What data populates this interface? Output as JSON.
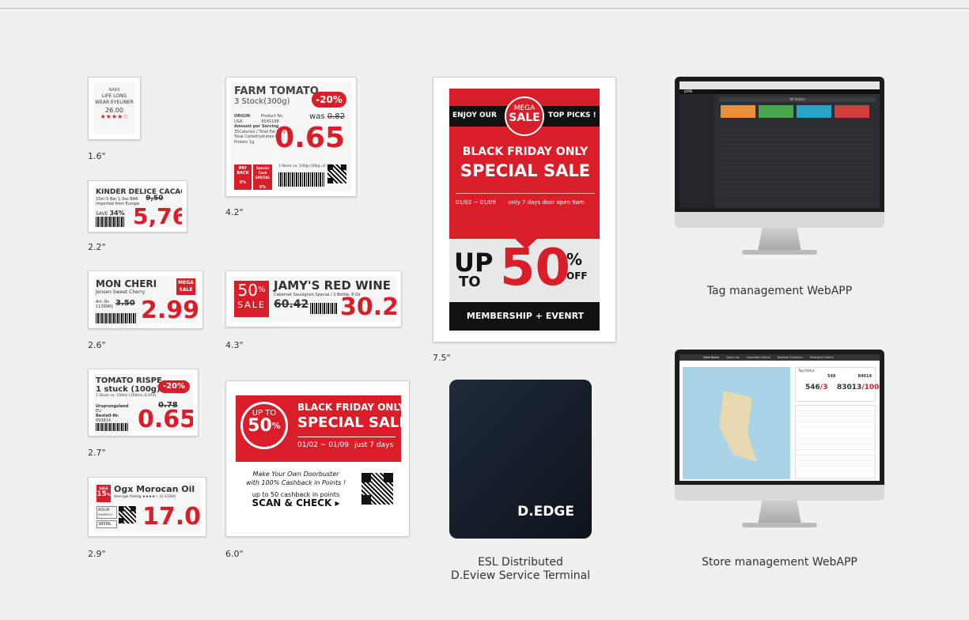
{
  "sizes": {
    "s16": "1.6\"",
    "s22": "2.2\"",
    "s26": "2.6\"",
    "s27": "2.7\"",
    "s29": "2.9\"",
    "s42": "4.2\"",
    "s43": "4.3\"",
    "s60": "6.0\"",
    "s75": "7.5\""
  },
  "tag16": {
    "brand": "NARS",
    "line1": "LIFE LONG",
    "line2": "WEAR EYELINER",
    "price": "26.00",
    "stars": "★★★★☆"
  },
  "tag22": {
    "title": "KINDER DELICE CACAO",
    "sub1": "15er 5 Bar 1.3oz BAR",
    "sub2": "Imported from Europe",
    "was": "9,50",
    "save_label": "SAVE",
    "save_pct": "34%",
    "price": "5,76"
  },
  "tag26": {
    "title": "MON CHERI",
    "sub": "Jensen Sweet Cherry",
    "badge1": "MEGA",
    "badge2": "SALE",
    "art": "Art.-Nr.",
    "artno": "1139981",
    "was": "3.50",
    "price": "2.99"
  },
  "tag27": {
    "title1": "TOMATO RISPE",
    "title2": "1 stuck (100g)",
    "badge": "-20%",
    "line": "1 Stuck ca. 150ml (100ml=0,474)",
    "origin": "Ursprungsland",
    "origin_val": "EU",
    "bestell": "Bestell-Nr.",
    "bestell_no": "093814",
    "was": "0.78",
    "price": "0.65"
  },
  "tag29": {
    "badge_top": "SALE",
    "badge_num": "15",
    "badge_pct": "%",
    "title": "Ogx Morocan Oil",
    "rating": "Average Rating ★★★★☆ (4.1/284)",
    "sub1": "AQUA",
    "sub2": "SHAMPOO",
    "size": "385ML",
    "price": "17.00"
  },
  "tag42": {
    "title": "FARM TOMATO",
    "sub": "3 Stock(300g)",
    "badge": "-20%",
    "origin_label": "ORIGIN",
    "origin": "USA",
    "prod_label": "Product No.",
    "prod": "8545198",
    "amount": "Amount per Serving",
    "cal": "35Calories / Total Fat 0.2g",
    "carb": "Total Carbohydrates 6g",
    "protein": "Protein 1g",
    "was_label": "was",
    "was": "0.82",
    "price": "0.65",
    "payback1": "PAY",
    "payback2": "BACK",
    "pb_pct": "5%",
    "special1": "Special Cash",
    "special2": "SPECIAL",
    "sp_pct": "5%",
    "stock": "1 Steck ca. 100g (100g=0.33)"
  },
  "tag43": {
    "pct": "50",
    "pct_sym": "%",
    "sale": "SALE",
    "title": "JAMY'S RED WINE",
    "sub": "Cabernet Sauvignon Special / 1 Bottle, 8 Oz",
    "was": "60.42",
    "price": "30.21"
  },
  "tag60": {
    "circle1": "UP TO",
    "circle2": "50",
    "circle3": "%",
    "line1": "BLACK FRIDAY ONLY",
    "line2": "SPECIAL SALE",
    "dates": "01/02 ~ 01/09",
    "days": "just 7 days",
    "doorbuster1": "Make Your Own Doorbuster",
    "doorbuster2": "with 100% Cashback in Points !",
    "cashback": "up to 50 cashback in points",
    "scan": "SCAN & CHECK ▸"
  },
  "tag75": {
    "enjoy": "ENJOY OUR",
    "mega": "MEGA",
    "sale": "SALE",
    "top": "TOP PICKS !",
    "bf": "BLACK FRIDAY ONLY",
    "special": "SPECIAL SALE",
    "dates": "01/02 ~ 01/09",
    "days": "only 7 days door open 9am",
    "up": "UP",
    "to": "TO",
    "fifty": "50",
    "pct": "%",
    "off": "OFF",
    "membership": "MEMBERSHIP + EVENRT"
  },
  "terminal": {
    "brand": "D.EDGE",
    "caption1": "ESL Distributed",
    "caption2": "D.Eview Service Terminal"
  },
  "tagapp": {
    "caption": "Tag management WebAPP",
    "logo": "JOMS",
    "header": "All Status"
  },
  "storeapp": {
    "caption": "Store management WebAPP",
    "tabs": [
      "Dash Board",
      "Store List",
      "Operation Status",
      "Network Evolution",
      "Statistical Status"
    ],
    "title": "Tag Status",
    "num1": "549",
    "num2": "84014",
    "num3": "546",
    "num4": "/3",
    "num5": "83013",
    "num6": "/1001"
  }
}
